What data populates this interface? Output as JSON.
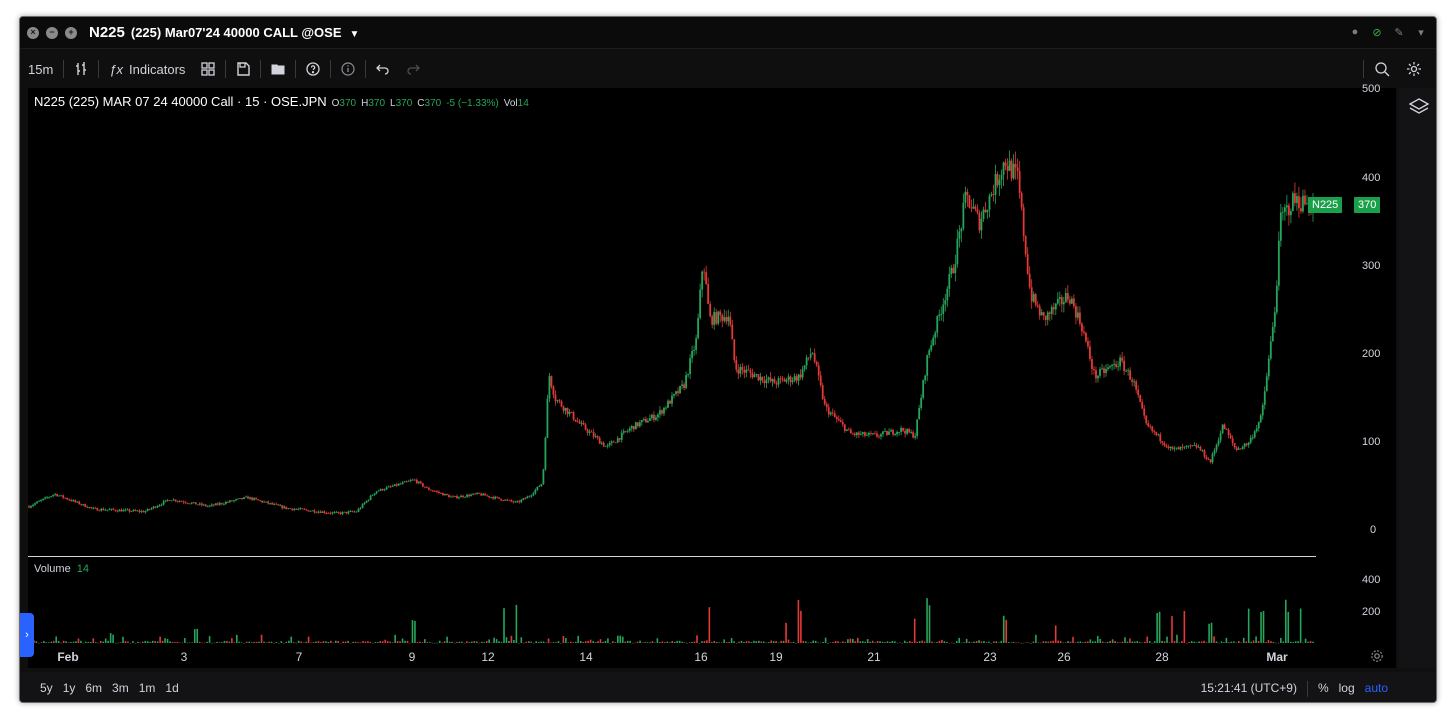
{
  "window": {
    "title": "N225",
    "subtitle": "(225) Mar07'24 40000 CALL @OSE"
  },
  "toolbar": {
    "interval": "15m",
    "indicators_label": "Indicators"
  },
  "legend": {
    "symbol": "N225 (225) MAR 07 24 40000 Call · 15 · OSE.JPN",
    "open_key": "O",
    "open_val": "370",
    "high_key": "H",
    "high_val": "370",
    "low_key": "L",
    "low_val": "370",
    "close_key": "C",
    "close_val": "370",
    "change": "-5 (−1.33%)",
    "vol_key": "Vol",
    "vol_val": "14"
  },
  "price_axis": {
    "ticks": [
      "500",
      "400",
      "300",
      "200",
      "100",
      "0"
    ]
  },
  "price_tag": {
    "label": "N225",
    "value": "370"
  },
  "volume_pane": {
    "label": "Volume",
    "value": "14",
    "ticks": [
      "400",
      "200"
    ]
  },
  "time_axis": {
    "ticks": [
      "Feb",
      "3",
      "7",
      "9",
      "12",
      "14",
      "16",
      "19",
      "21",
      "23",
      "26",
      "28",
      "Mar"
    ]
  },
  "bottombar": {
    "ranges": [
      "5y",
      "1y",
      "6m",
      "3m",
      "1m",
      "1d"
    ],
    "clock": "15:21:41 (UTC+9)",
    "percent": "%",
    "log": "log",
    "auto": "auto"
  },
  "colors": {
    "up": "#26a65b",
    "down": "#e53935",
    "accent": "#2962ff",
    "tag": "#1aa04a"
  },
  "chart_data": {
    "type": "candlestick",
    "title": "N225 (225) MAR 07 24 40000 Call · 15 · OSE.JPN",
    "x": [
      "Feb",
      "3",
      "7",
      "9",
      "12",
      "14",
      "16",
      "19",
      "21",
      "23",
      "26",
      "28",
      "Mar"
    ],
    "ylim": [
      0,
      500
    ],
    "price_path": [
      [
        0,
        28
      ],
      [
        0.02,
        42
      ],
      [
        0.05,
        25
      ],
      [
        0.09,
        22
      ],
      [
        0.11,
        36
      ],
      [
        0.14,
        28
      ],
      [
        0.17,
        38
      ],
      [
        0.2,
        26
      ],
      [
        0.24,
        20
      ],
      [
        0.255,
        22
      ],
      [
        0.27,
        45
      ],
      [
        0.3,
        58
      ],
      [
        0.31,
        48
      ],
      [
        0.33,
        38
      ],
      [
        0.35,
        42
      ],
      [
        0.38,
        32
      ],
      [
        0.39,
        40
      ],
      [
        0.4,
        55
      ],
      [
        0.405,
        178
      ],
      [
        0.41,
        150
      ],
      [
        0.43,
        120
      ],
      [
        0.45,
        95
      ],
      [
        0.47,
        118
      ],
      [
        0.49,
        132
      ],
      [
        0.51,
        165
      ],
      [
        0.52,
        218
      ],
      [
        0.525,
        310
      ],
      [
        0.53,
        240
      ],
      [
        0.545,
        245
      ],
      [
        0.55,
        185
      ],
      [
        0.56,
        180
      ],
      [
        0.58,
        168
      ],
      [
        0.6,
        175
      ],
      [
        0.61,
        205
      ],
      [
        0.62,
        140
      ],
      [
        0.64,
        110
      ],
      [
        0.66,
        108
      ],
      [
        0.68,
        115
      ],
      [
        0.69,
        108
      ],
      [
        0.7,
        200
      ],
      [
        0.71,
        250
      ],
      [
        0.72,
        300
      ],
      [
        0.73,
        380
      ],
      [
        0.74,
        350
      ],
      [
        0.76,
        420
      ],
      [
        0.77,
        400
      ],
      [
        0.78,
        268
      ],
      [
        0.79,
        240
      ],
      [
        0.81,
        268
      ],
      [
        0.82,
        232
      ],
      [
        0.83,
        175
      ],
      [
        0.85,
        192
      ],
      [
        0.86,
        170
      ],
      [
        0.87,
        120
      ],
      [
        0.89,
        92
      ],
      [
        0.91,
        96
      ],
      [
        0.92,
        78
      ],
      [
        0.93,
        120
      ],
      [
        0.94,
        92
      ],
      [
        0.95,
        100
      ],
      [
        0.96,
        130
      ],
      [
        0.97,
        245
      ],
      [
        0.975,
        355
      ],
      [
        0.985,
        375
      ],
      [
        1,
        370
      ]
    ],
    "volume_peaks": [
      [
        0.065,
        60
      ],
      [
        0.13,
        75
      ],
      [
        0.3,
        130
      ],
      [
        0.37,
        250
      ],
      [
        0.38,
        230
      ],
      [
        0.53,
        240
      ],
      [
        0.59,
        150
      ],
      [
        0.6,
        240
      ],
      [
        0.69,
        180
      ],
      [
        0.7,
        240
      ],
      [
        0.76,
        150
      ],
      [
        0.8,
        120
      ],
      [
        0.88,
        200
      ],
      [
        0.89,
        170
      ],
      [
        0.9,
        240
      ],
      [
        0.92,
        120
      ],
      [
        0.95,
        240
      ],
      [
        0.96,
        210
      ],
      [
        0.98,
        230
      ],
      [
        0.99,
        220
      ]
    ]
  }
}
